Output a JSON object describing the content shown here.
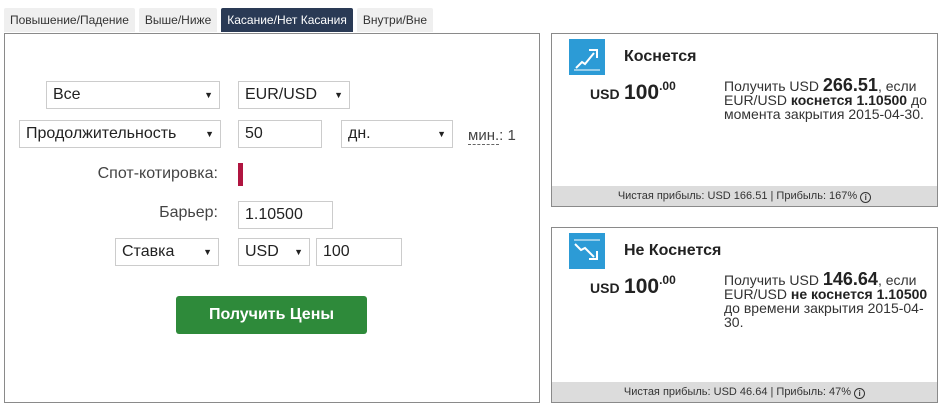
{
  "tabs": [
    {
      "label": "Повышение/Падение"
    },
    {
      "label": "Выше/Ниже"
    },
    {
      "label": "Касание/Нет Касания"
    },
    {
      "label": "Внутри/Вне"
    }
  ],
  "form": {
    "market_select": "Все",
    "asset_select": "EUR/USD",
    "duration_type_select": "Продолжительность",
    "duration_value": "50",
    "duration_unit_select": "дн.",
    "min_label": "мин.",
    "min_value": ": 1",
    "spot_label": "Спот-котировка:",
    "barrier_label": "Барьер:",
    "barrier_value": "1.10500",
    "basis_select": "Ставка",
    "currency_select": "USD",
    "amount_value": "100",
    "get_prices_button": "Получить Цены"
  },
  "cards": {
    "touch": {
      "icon": "touch-chart-icon",
      "title": "Коснется",
      "currency": "USD",
      "amount": "100",
      "cents": ".00",
      "desc_pre": "Получить USD ",
      "payout": "266.51",
      "desc_mid1": ", если EUR/USD ",
      "condition": "коснется 1.10500",
      "desc_post": " до момента закрытия 2015-04-30.",
      "footer": "Чистая прибыль: USD 166.51 | Прибыль: 167%"
    },
    "notouch": {
      "icon": "no-touch-chart-icon",
      "title": "Не Коснется",
      "currency": "USD",
      "amount": "100",
      "cents": ".00",
      "desc_pre": "Получить USD ",
      "payout": "146.64",
      "desc_mid1": ", если EUR/USD ",
      "condition": "не коснется 1.10500",
      "desc_post": " до времени закрытия 2015-04-30.",
      "footer": "Чистая прибыль: USD 46.64 | Прибыль: 47%"
    }
  },
  "colors": {
    "active_tab": "#2a3a55",
    "button": "#2e8a3a",
    "icon_bg": "#2c9bd6",
    "spot_marker": "#b01540"
  }
}
